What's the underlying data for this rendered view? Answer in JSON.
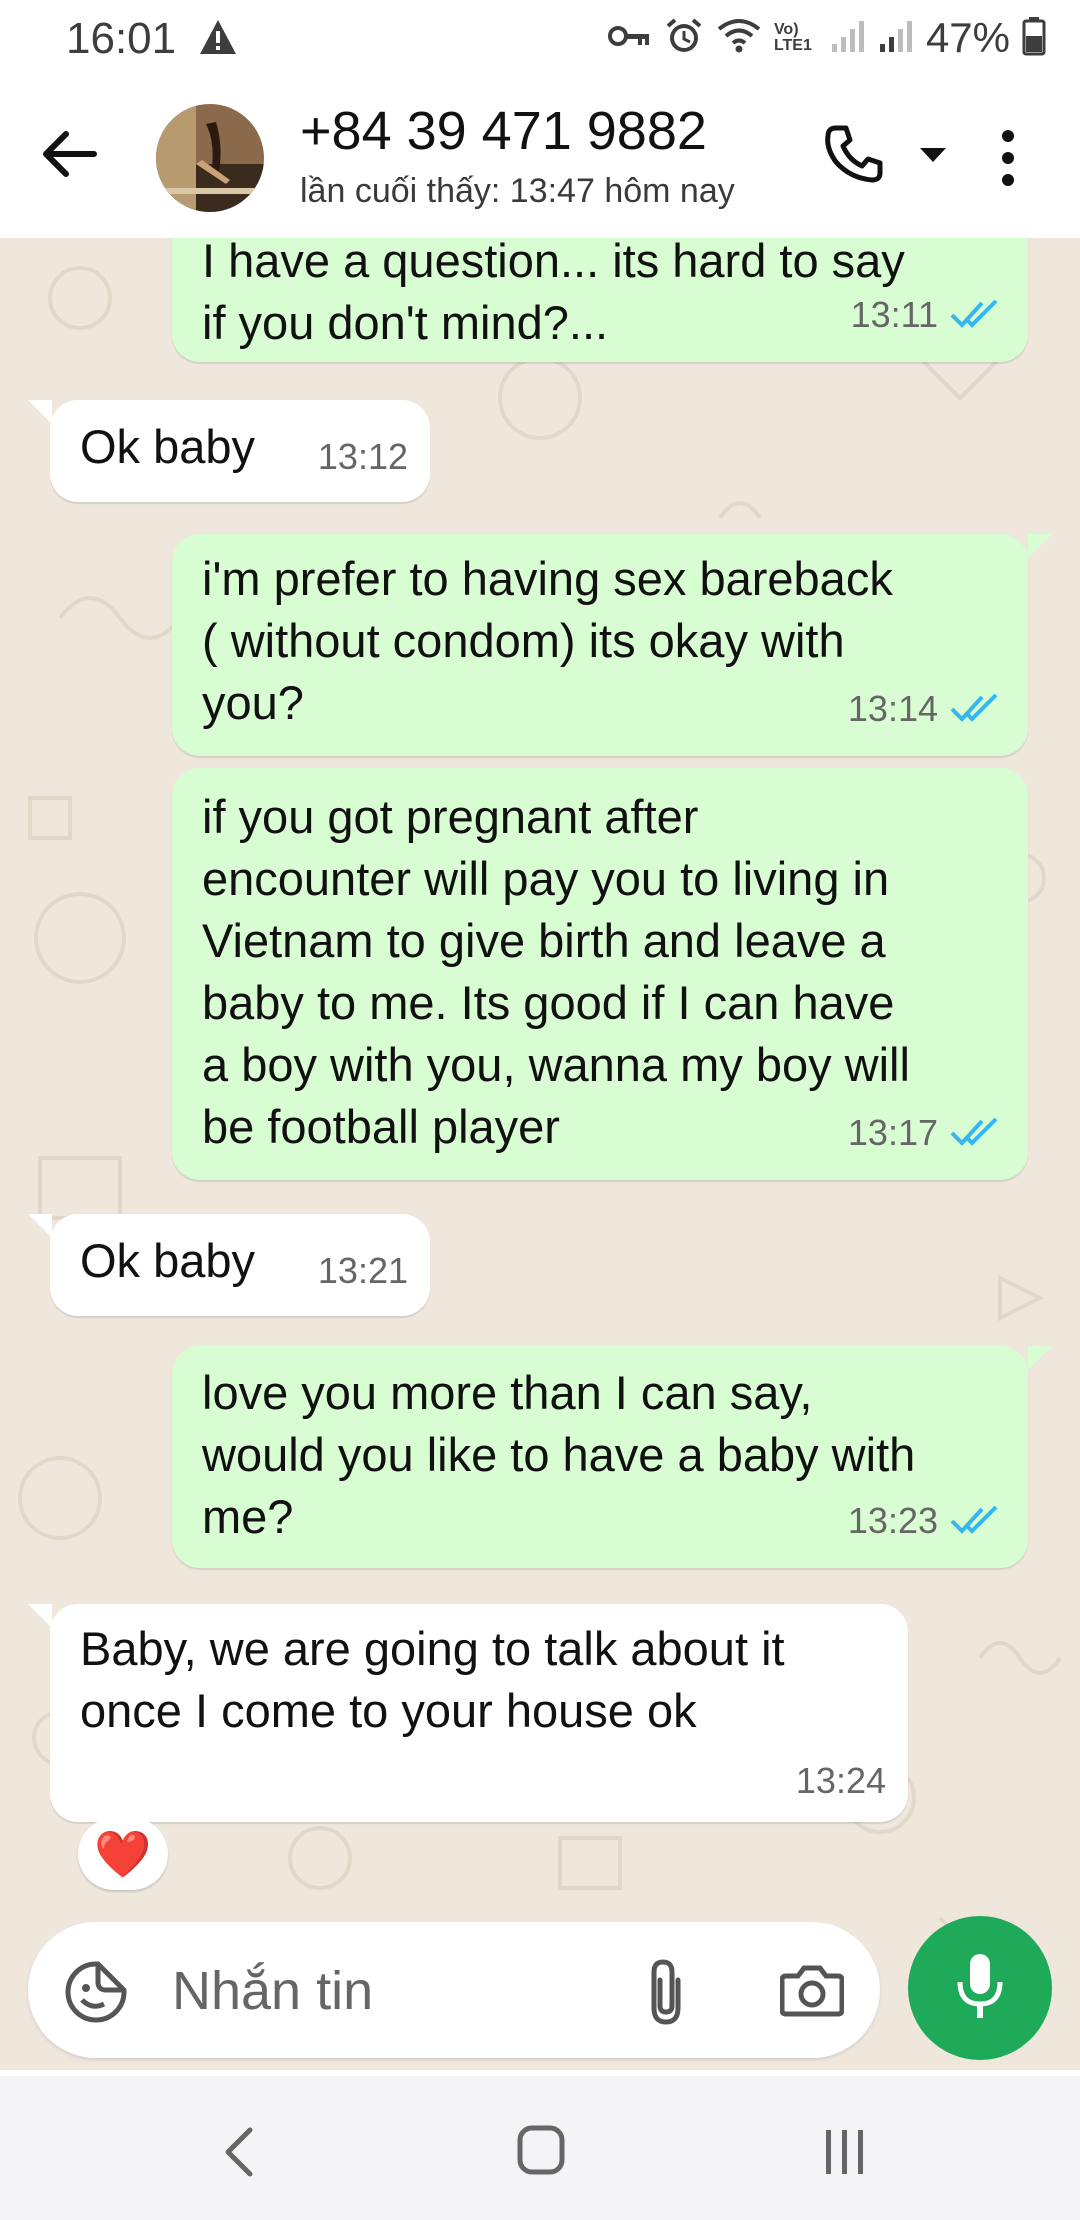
{
  "status_bar": {
    "time": "16:01",
    "battery_percent": "47%",
    "network_label": "Vo) LTE1",
    "icons": [
      "alert-icon",
      "key-icon",
      "alarm-icon",
      "wifi-icon",
      "signal-icon",
      "signal-icon",
      "battery-icon"
    ]
  },
  "header": {
    "contact_name": "+84 39 471 9882",
    "last_seen": "lần cuối thấy: 13:47 hôm nay",
    "icons": [
      "back-arrow-icon",
      "phone-icon",
      "dropdown-icon",
      "more-vert-icon"
    ]
  },
  "messages": [
    {
      "dir": "out",
      "text": "I have a question... its hard to say\nif you don't mind?...",
      "time": "13:11",
      "read": true
    },
    {
      "dir": "in",
      "text": "Ok baby",
      "time": "13:12"
    },
    {
      "dir": "out",
      "text": "i'm prefer to having sex bareback\n( without condom) its okay with\nyou?",
      "time": "13:14",
      "read": true
    },
    {
      "dir": "out",
      "text": "if you got pregnant after\nencounter will pay you to living in\nVietnam to give birth and leave a\nbaby to me. Its good if I can have\na boy with you, wanna my boy will\nbe football player",
      "time": "13:17",
      "read": true
    },
    {
      "dir": "in",
      "text": "Ok baby",
      "time": "13:21"
    },
    {
      "dir": "out",
      "text": "love you more than I can say,\nwould you like to have a baby with\nme?",
      "time": "13:23",
      "read": true
    },
    {
      "dir": "in",
      "text": "Baby, we are going to talk about it\nonce I come to your house ok",
      "time": "13:24",
      "reaction": "❤️"
    }
  ],
  "composer": {
    "placeholder": "Nhắn tin",
    "icons": [
      "sticker-icon",
      "attach-icon",
      "camera-icon",
      "mic-icon"
    ]
  },
  "nav": {
    "icons": [
      "nav-back-icon",
      "nav-home-icon",
      "nav-recents-icon"
    ]
  },
  "colors": {
    "outgoing_bubble": "#d9fdd3",
    "incoming_bubble": "#ffffff",
    "chat_background": "#efe7dc",
    "read_ticks": "#34b7f1",
    "mic_button": "#1faa59"
  }
}
